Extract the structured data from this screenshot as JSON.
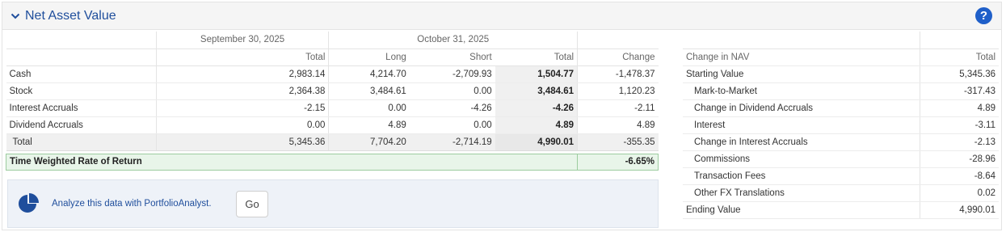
{
  "section": {
    "title": "Net Asset Value",
    "help": "?"
  },
  "nav": {
    "groups": [
      "September 30, 2025",
      "October 31, 2025"
    ],
    "columns": [
      "Total",
      "Long",
      "Short",
      "Total",
      "Change"
    ],
    "rows": [
      {
        "label": "Cash",
        "values": [
          "2,983.14",
          "4,214.70",
          "-2,709.93",
          "1,504.77",
          "-1,478.37"
        ]
      },
      {
        "label": "Stock",
        "values": [
          "2,364.38",
          "3,484.61",
          "0.00",
          "3,484.61",
          "1,120.23"
        ]
      },
      {
        "label": "Interest Accruals",
        "values": [
          "-2.15",
          "0.00",
          "-4.26",
          "-4.26",
          "-2.11"
        ]
      },
      {
        "label": "Dividend Accruals",
        "values": [
          "0.00",
          "4.89",
          "0.00",
          "4.89",
          "4.89"
        ]
      }
    ],
    "total": {
      "label": "Total",
      "values": [
        "5,345.36",
        "7,704.20",
        "-2,714.19",
        "4,990.01",
        "-355.35"
      ]
    },
    "twr": {
      "label": "Time Weighted Rate of Return",
      "value": "-6.65%"
    }
  },
  "analyze": {
    "text": "Analyze this data with PortfolioAnalyst.",
    "button": "Go"
  },
  "change_in_nav": {
    "header_label": "Change in NAV",
    "header_total": "Total",
    "rows": [
      {
        "label": "Starting Value",
        "value": "5,345.36"
      },
      {
        "label": "Mark-to-Market",
        "value": "-317.43"
      },
      {
        "label": "Change in Dividend Accruals",
        "value": "4.89"
      },
      {
        "label": "Interest",
        "value": "-3.11"
      },
      {
        "label": "Change in Interest Accruals",
        "value": "-2.13"
      },
      {
        "label": "Commissions",
        "value": "-28.96"
      },
      {
        "label": "Transaction Fees",
        "value": "-8.64"
      },
      {
        "label": "Other FX Translations",
        "value": "0.02"
      },
      {
        "label": "Ending Value",
        "value": "4,990.01"
      }
    ]
  },
  "colors": {
    "accent": "#1f4e9c",
    "help_bg": "#1f5fc9",
    "twr_bg": "#e8f5e9"
  }
}
